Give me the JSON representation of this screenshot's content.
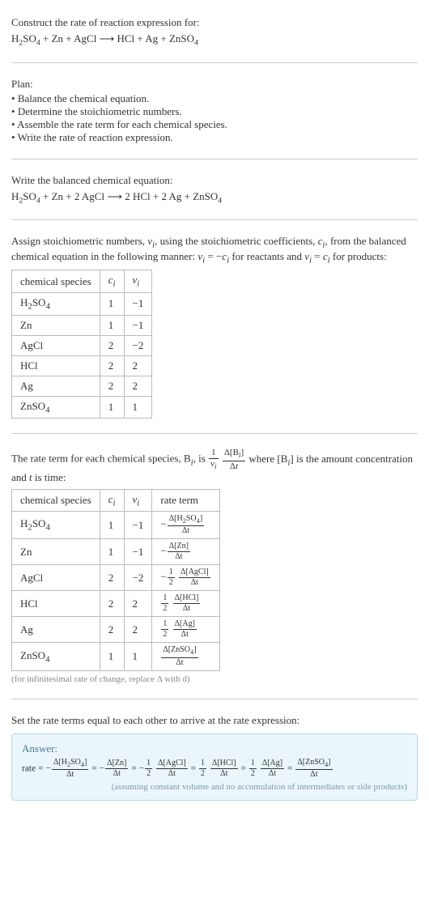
{
  "prompt": {
    "title": "Construct the rate of reaction expression for:",
    "equation_html": "H<sub>2</sub>SO<sub>4</sub> + Zn + AgCl&nbsp;⟶&nbsp;HCl + Ag + ZnSO<sub>4</sub>"
  },
  "plan": {
    "label": "Plan:",
    "items": [
      "Balance the chemical equation.",
      "Determine the stoichiometric numbers.",
      "Assemble the rate term for each chemical species.",
      "Write the rate of reaction expression."
    ]
  },
  "balanced": {
    "label": "Write the balanced chemical equation:",
    "equation_html": "H<sub>2</sub>SO<sub>4</sub> + Zn + 2 AgCl&nbsp;⟶&nbsp;2 HCl + 2 Ag + ZnSO<sub>4</sub>"
  },
  "stoich_intro_html": "Assign stoichiometric numbers, <span class='ital'>ν<sub>i</sub></span>, using the stoichiometric coefficients, <span class='ital'>c<sub>i</sub></span>, from the balanced chemical equation in the following manner: <span class='ital'>ν<sub>i</sub></span> = −<span class='ital'>c<sub>i</sub></span> for reactants and <span class='ital'>ν<sub>i</sub></span> = <span class='ital'>c<sub>i</sub></span> for products:",
  "table1": {
    "headers": {
      "species": "chemical species",
      "c": "c<sub>i</sub>",
      "v": "ν<sub>i</sub>"
    },
    "rows": [
      {
        "species_html": "H<sub>2</sub>SO<sub>4</sub>",
        "c": "1",
        "v": "−1"
      },
      {
        "species_html": "Zn",
        "c": "1",
        "v": "−1"
      },
      {
        "species_html": "AgCl",
        "c": "2",
        "v": "−2"
      },
      {
        "species_html": "HCl",
        "c": "2",
        "v": "2"
      },
      {
        "species_html": "Ag",
        "c": "2",
        "v": "2"
      },
      {
        "species_html": "ZnSO<sub>4</sub>",
        "c": "1",
        "v": "1"
      }
    ]
  },
  "rate_intro_prefix": "The rate term for each chemical species, B",
  "rate_intro_prefix2": ", is ",
  "rate_intro_suffix_html": " where [B<sub><i>i</i></sub>] is the amount concentration and <span class='ital'>t</span> is time:",
  "rate_frac1": {
    "num": "1",
    "den": "ν<sub><i>i</i></sub>"
  },
  "rate_frac2": {
    "num": "Δ[B<sub><i>i</i></sub>]",
    "den": "Δ<span class='ital'>t</span>"
  },
  "table2": {
    "headers": {
      "species": "chemical species",
      "c": "c<sub>i</sub>",
      "v": "ν<sub>i</sub>",
      "rate": "rate term"
    },
    "rows": [
      {
        "species_html": "H<sub>2</sub>SO<sub>4</sub>",
        "c": "1",
        "v": "−1",
        "rate_neg": "−",
        "coef_num": "",
        "coef_den": "",
        "num": "Δ[H<sub>2</sub>SO<sub>4</sub>]",
        "den": "Δt"
      },
      {
        "species_html": "Zn",
        "c": "1",
        "v": "−1",
        "rate_neg": "−",
        "coef_num": "",
        "coef_den": "",
        "num": "Δ[Zn]",
        "den": "Δt"
      },
      {
        "species_html": "AgCl",
        "c": "2",
        "v": "−2",
        "rate_neg": "−",
        "coef_num": "1",
        "coef_den": "2",
        "num": "Δ[AgCl]",
        "den": "Δt"
      },
      {
        "species_html": "HCl",
        "c": "2",
        "v": "2",
        "rate_neg": "",
        "coef_num": "1",
        "coef_den": "2",
        "num": "Δ[HCl]",
        "den": "Δt"
      },
      {
        "species_html": "Ag",
        "c": "2",
        "v": "2",
        "rate_neg": "",
        "coef_num": "1",
        "coef_den": "2",
        "num": "Δ[Ag]",
        "den": "Δt"
      },
      {
        "species_html": "ZnSO<sub>4</sub>",
        "c": "1",
        "v": "1",
        "rate_neg": "",
        "coef_num": "",
        "coef_den": "",
        "num": "Δ[ZnSO<sub>4</sub>]",
        "den": "Δt"
      }
    ]
  },
  "infinitesimal_note": "(for infinitesimal rate of change, replace Δ with d)",
  "final_label": "Set the rate terms equal to each other to arrive at the rate expression:",
  "answer": {
    "title": "Answer:",
    "prefix": "rate = ",
    "terms": [
      {
        "neg": "−",
        "coef_num": "",
        "coef_den": "",
        "num": "Δ[H<sub>2</sub>SO<sub>4</sub>]",
        "den": "Δt"
      },
      {
        "neg": "−",
        "coef_num": "",
        "coef_den": "",
        "num": "Δ[Zn]",
        "den": "Δt"
      },
      {
        "neg": "−",
        "coef_num": "1",
        "coef_den": "2",
        "num": "Δ[AgCl]",
        "den": "Δt"
      },
      {
        "neg": "",
        "coef_num": "1",
        "coef_den": "2",
        "num": "Δ[HCl]",
        "den": "Δt"
      },
      {
        "neg": "",
        "coef_num": "1",
        "coef_den": "2",
        "num": "Δ[Ag]",
        "den": "Δt"
      },
      {
        "neg": "",
        "coef_num": "",
        "coef_den": "",
        "num": "Δ[ZnSO<sub>4</sub>]",
        "den": "Δt"
      }
    ],
    "note": "(assuming constant volume and no accumulation of intermediates or side products)"
  }
}
